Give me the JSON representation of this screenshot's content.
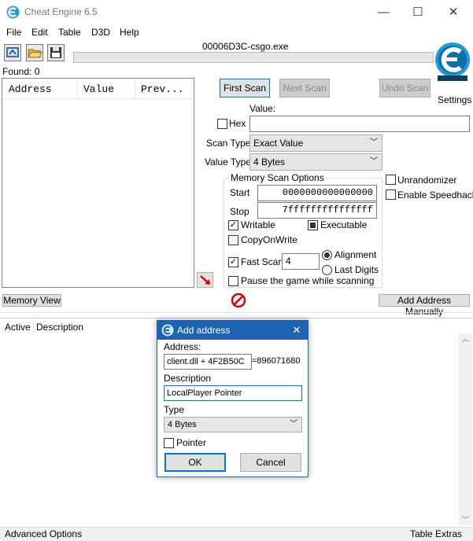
{
  "window": {
    "title": "Cheat Engine 6.5",
    "minimize": "—",
    "maximize": "☐",
    "close": "✕"
  },
  "menu": [
    "File",
    "Edit",
    "Table",
    "D3D",
    "Help"
  ],
  "process_name": "00006D3C-csgo.exe",
  "found": "Found: 0",
  "results_columns": [
    "Address",
    "Value",
    "Prev..."
  ],
  "buttons": {
    "first_scan": "First Scan",
    "next_scan": "Next Scan",
    "undo_scan": "Undo Scan",
    "settings": "Settings",
    "memory_view": "Memory View",
    "add_address_manually": "Add Address Manually"
  },
  "scan": {
    "value_label": "Value:",
    "hex_label": "Hex",
    "hex_checked": false,
    "value": "",
    "scan_type_label": "Scan Type",
    "scan_type": "Exact Value",
    "value_type_label": "Value Type",
    "value_type": "4 Bytes",
    "memory_options_label": "Memory Scan Options",
    "start_label": "Start",
    "start": "0000000000000000",
    "stop_label": "Stop",
    "stop": "7fffffffffffffff",
    "writable": "Writable",
    "writable_checked": true,
    "executable": "Executable",
    "executable_state": "partial",
    "copy_on_write": "CopyOnWrite",
    "copy_on_write_checked": false,
    "fast_scan": "Fast Scan",
    "fast_scan_checked": true,
    "fast_scan_value": "4",
    "alignment": "Alignment",
    "last_digits": "Last Digits",
    "alignment_selected": true,
    "pause": "Pause the game while scanning",
    "pause_checked": false,
    "unrandomizer": "Unrandomizer",
    "unrandomizer_checked": false,
    "speedhack": "Enable Speedhack",
    "speedhack_checked": false
  },
  "table_columns": [
    "Active",
    "Description"
  ],
  "footer": {
    "advanced": "Advanced Options",
    "extras": "Table Extras"
  },
  "dialog": {
    "title": "Add address",
    "close": "✕",
    "address_label": "Address:",
    "address": "client.dll + 4F2B50C",
    "address_value": "=896071680",
    "description_label": "Description",
    "description": "LocalPlayer Pointer",
    "type_label": "Type",
    "type": "4 Bytes",
    "pointer_label": "Pointer",
    "pointer_checked": false,
    "ok": "OK",
    "cancel": "Cancel"
  },
  "icons": {
    "app": "cheat-engine-logo-icon",
    "process": "select-process-icon",
    "open": "open-folder-icon",
    "save": "save-disk-icon",
    "arrow": "red-arrow-icon",
    "stop": "stop-icon"
  },
  "colors": {
    "accent": "#0078d7",
    "dialog_title": "#1e62b4",
    "logo": "#1e9bd8"
  }
}
